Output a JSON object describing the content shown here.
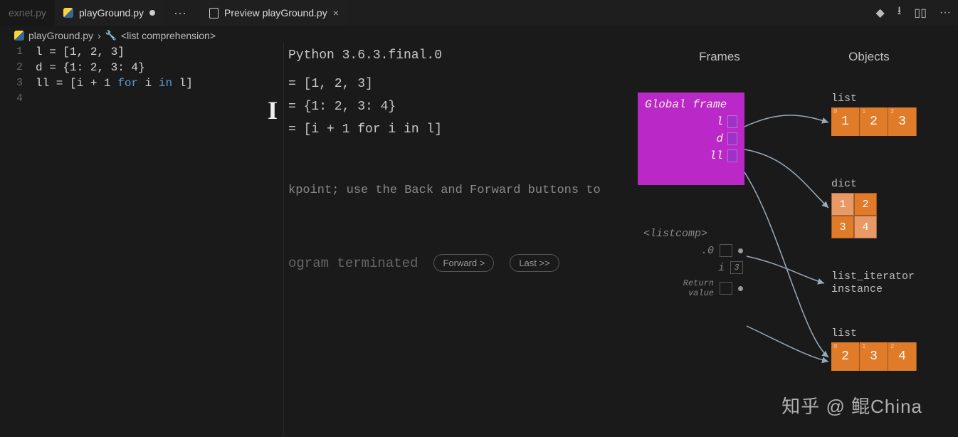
{
  "tabs": {
    "left_inactive": "exnet.py",
    "active": "playGround.py",
    "preview": "Preview playGround.py",
    "overflow": "···",
    "close": "×"
  },
  "title_actions": {
    "more": "···"
  },
  "breadcrumb": {
    "file": "playGround.py",
    "sep": "›",
    "scope": "<list comprehension>"
  },
  "editor_lines": {
    "l1_no": "1",
    "l1": "l = [1, 2, 3]",
    "l2_no": "2",
    "l2": "d = {1: 2, 3: 4}",
    "l3_no": "3",
    "l3_pre": "ll = [",
    "l3_mid": "i + 1 ",
    "l3_for": "for",
    "l3_sp": " i ",
    "l3_in": "in",
    "l3_end": " l]",
    "l4_no": "4"
  },
  "preview": {
    "python": "Python 3.6.3.final.0",
    "line1": "= [1, 2, 3]",
    "line2": "= {1: 2, 3: 4}",
    "line3": "= [i + 1 for i in l]",
    "hint": "kpoint; use the Back and Forward buttons to",
    "terminated": "ogram terminated",
    "forward_btn": "Forward >",
    "last_btn": "Last >>"
  },
  "frames": {
    "frames_hdr": "Frames",
    "objects_hdr": "Objects",
    "global_title": "Global frame",
    "vars": {
      "v1": "l",
      "v2": "d",
      "v3": "ll"
    },
    "listcomp_title": "<listcomp>",
    "lc_var1": ".0",
    "lc_var2": "i",
    "lc_val2": "3",
    "lc_return": "Return\nvalue"
  },
  "objects": {
    "list1_label": "list",
    "list1": [
      "1",
      "2",
      "3"
    ],
    "dict_label": "dict",
    "dict": [
      "1",
      "2",
      "3",
      "4"
    ],
    "iter_label": "list_iterator\ninstance",
    "list2_label": "list",
    "list2": [
      "2",
      "3",
      "4"
    ]
  },
  "watermark": "知乎 @ 鲲China"
}
